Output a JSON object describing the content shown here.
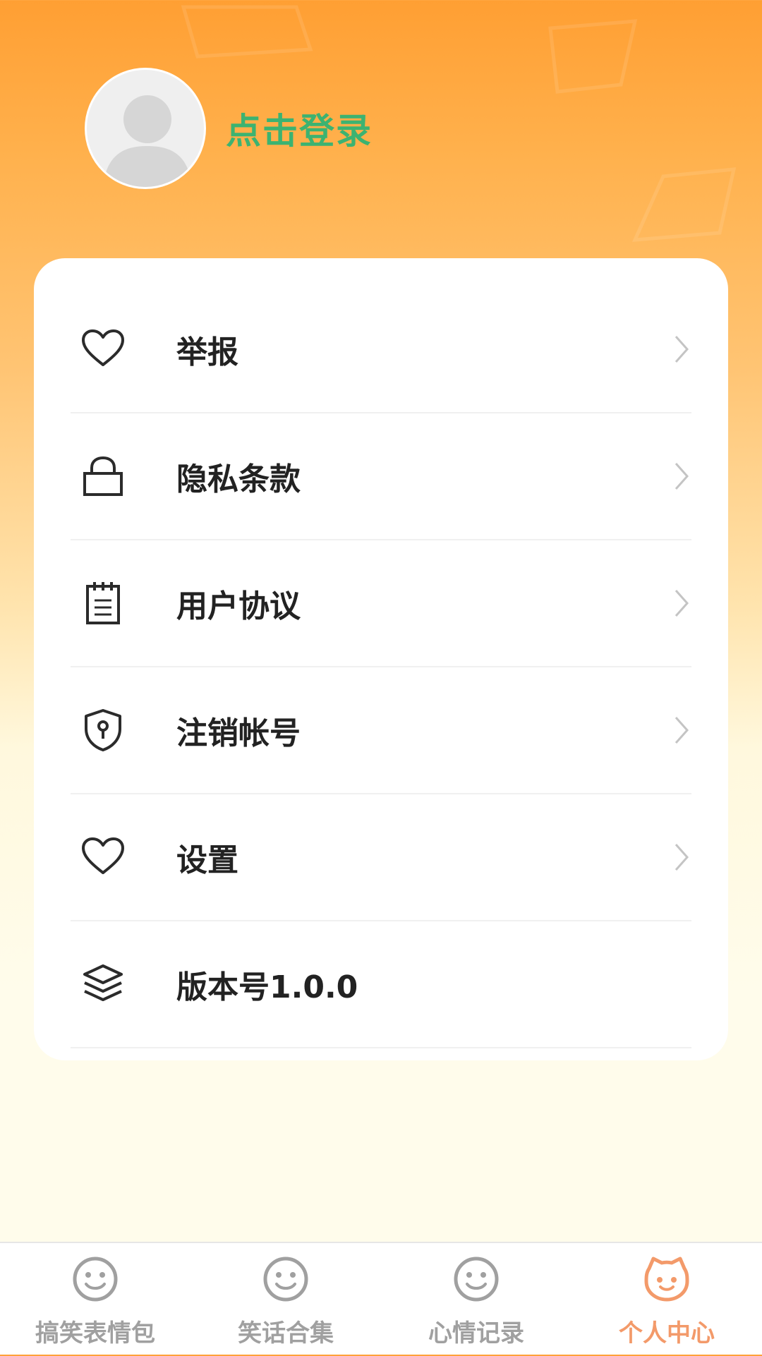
{
  "header": {
    "login_text": "点击登录"
  },
  "menu": {
    "items": [
      {
        "label": "举报",
        "icon": "heart-icon"
      },
      {
        "label": "隐私条款",
        "icon": "lock-icon"
      },
      {
        "label": "用户协议",
        "icon": "notepad-icon"
      },
      {
        "label": "注销帐号",
        "icon": "shield-key-icon"
      },
      {
        "label": "设置",
        "icon": "heart-icon"
      },
      {
        "label": "版本号1.0.0",
        "icon": "layers-icon"
      }
    ]
  },
  "tabbar": {
    "tabs": [
      {
        "label": "搞笑表情包",
        "icon": "smiley-icon",
        "active": false
      },
      {
        "label": "笑话合集",
        "icon": "smiley-icon",
        "active": false
      },
      {
        "label": "心情记录",
        "icon": "smiley-icon",
        "active": false
      },
      {
        "label": "个人中心",
        "icon": "cat-face-icon",
        "active": true
      }
    ]
  },
  "colors": {
    "login_green": "#3CB371",
    "active_tab": "#F39A6A",
    "inactive_tab": "#A0A0A0",
    "header_orange": "#FF9F33"
  }
}
